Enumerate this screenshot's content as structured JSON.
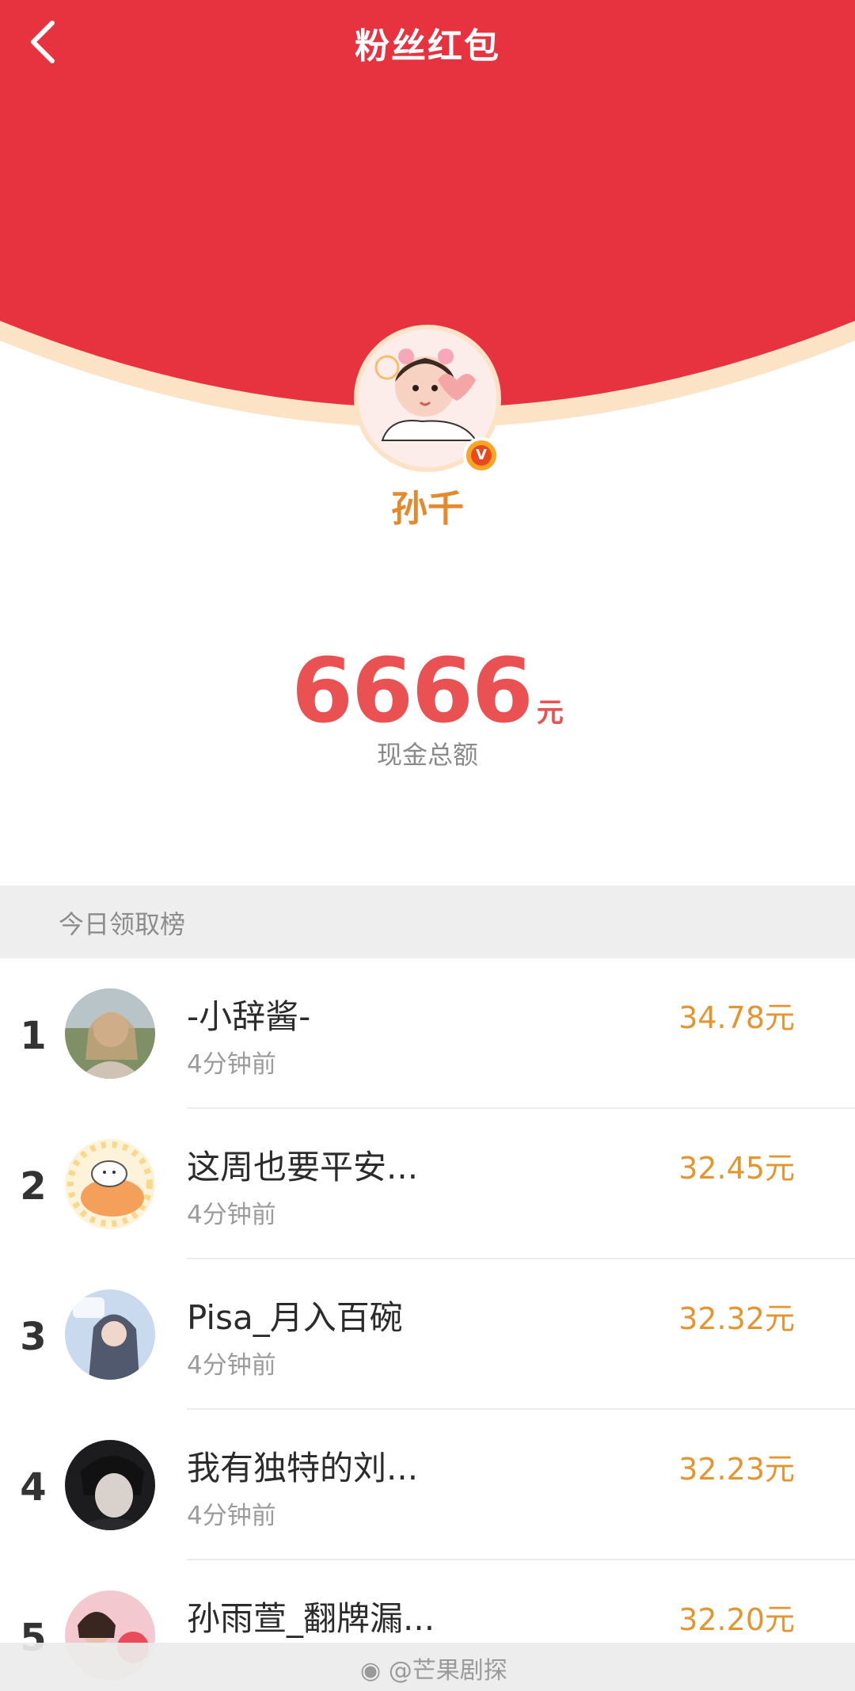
{
  "header": {
    "title": "粉丝红包",
    "back_icon": "chevron-left-icon",
    "colors": {
      "red": "#e7323f",
      "cream": "#fde3c6"
    }
  },
  "creator": {
    "name": "孙千",
    "verified_badge": "V"
  },
  "total": {
    "amount": "6666",
    "unit": "元",
    "label": "现金总额"
  },
  "leaderboard": {
    "title": "今日领取榜",
    "rows": [
      {
        "rank": "1",
        "name": "-小辞酱-",
        "time": "4分钟前",
        "amount": "34.78元"
      },
      {
        "rank": "2",
        "name": "这周也要平安...",
        "time": "4分钟前",
        "amount": "32.45元"
      },
      {
        "rank": "3",
        "name": "Pisa_月入百碗",
        "time": "4分钟前",
        "amount": "32.32元"
      },
      {
        "rank": "4",
        "name": "我有独特的刘...",
        "time": "4分钟前",
        "amount": "32.23元"
      },
      {
        "rank": "5",
        "name": "孙雨萱_翻牌漏...",
        "time": "",
        "amount": "32.20元"
      }
    ]
  },
  "watermark": {
    "text": "@芒果剧探"
  }
}
